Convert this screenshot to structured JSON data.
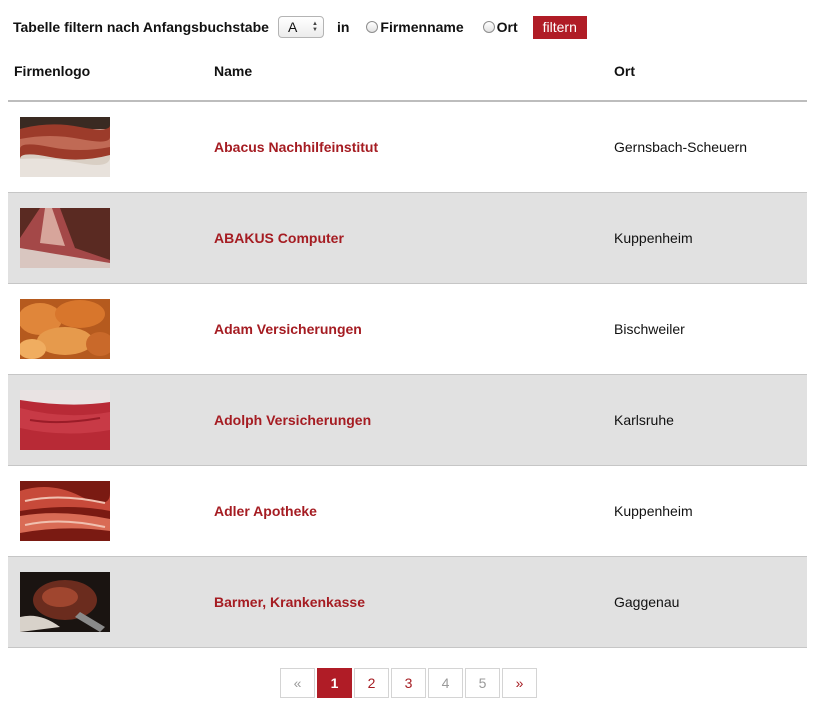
{
  "filter": {
    "label": "Tabelle filtern nach Anfangsbuchstabe",
    "letter": "A",
    "in_label": "in",
    "option_firmenname": "Firmenname",
    "option_ort": "Ort",
    "button_label": "filtern"
  },
  "table": {
    "headers": {
      "logo": "Firmenlogo",
      "name": "Name",
      "ort": "Ort"
    },
    "rows": [
      {
        "name": "Abacus Nachhilfeinstitut",
        "ort": "Gernsbach-Scheuern",
        "logo_icon": "meat-photo"
      },
      {
        "name": "ABAKUS Computer",
        "ort": "Kuppenheim",
        "logo_icon": "meat-photo"
      },
      {
        "name": "Adam Versicherungen",
        "ort": "Bischweiler",
        "logo_icon": "roast-chicken-photo"
      },
      {
        "name": "Adolph Versicherungen",
        "ort": "Karlsruhe",
        "logo_icon": "raw-beef-photo"
      },
      {
        "name": "Adler Apotheke",
        "ort": "Kuppenheim",
        "logo_icon": "ham-photo"
      },
      {
        "name": "Barmer, Krankenkasse",
        "ort": "Gaggenau",
        "logo_icon": "steak-photo"
      }
    ]
  },
  "pagination": {
    "prev": "«",
    "pages": [
      "1",
      "2",
      "3",
      "4",
      "5"
    ],
    "next": "»",
    "current": "1"
  },
  "colors": {
    "accent": "#b01c26",
    "link": "#a51c22",
    "row_alt": "#e1e1e1"
  }
}
